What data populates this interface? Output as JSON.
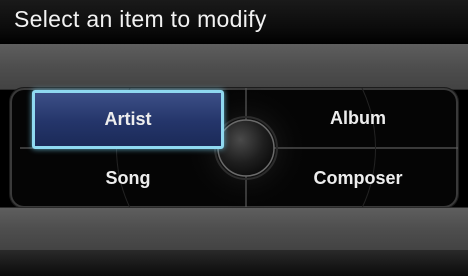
{
  "header": {
    "title": "Select an item to modify"
  },
  "options": [
    {
      "label": "Artist",
      "selected": true
    },
    {
      "label": "Album",
      "selected": false
    },
    {
      "label": "Song",
      "selected": false
    },
    {
      "label": "Composer",
      "selected": false
    }
  ],
  "colors": {
    "selection_border": "#8fd9f0",
    "selection_fill": "#2b3c74",
    "band_gray": "#555555"
  }
}
